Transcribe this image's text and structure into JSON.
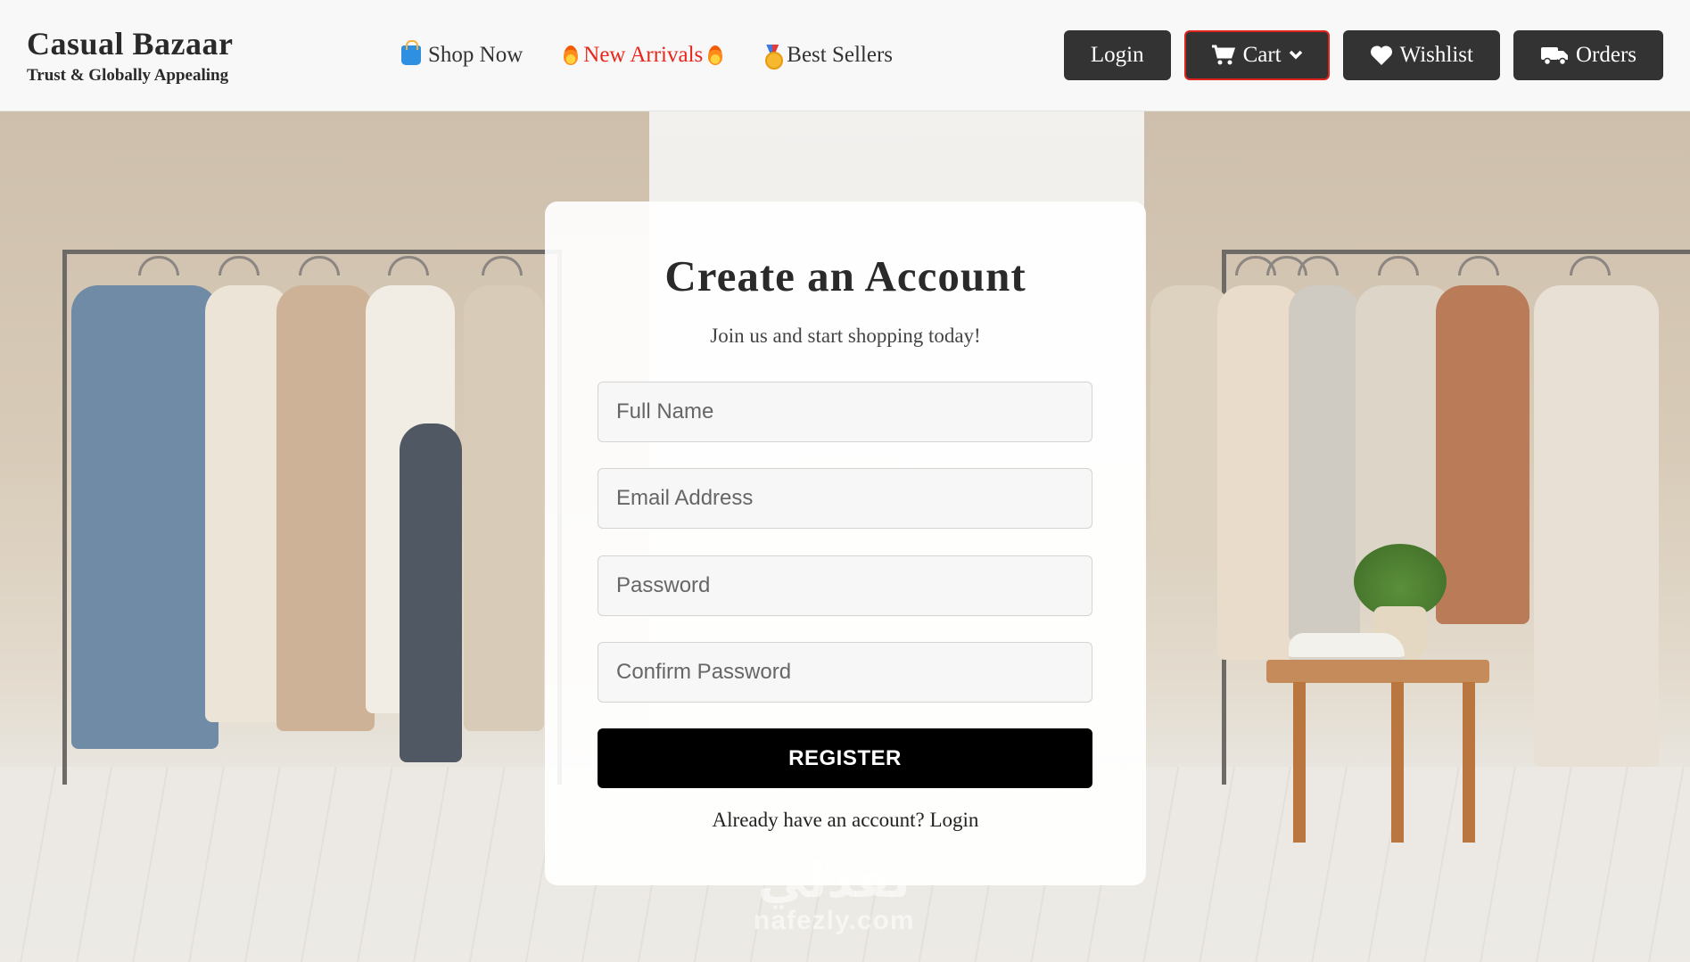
{
  "header": {
    "brand_name": "Casual Bazaar",
    "brand_tagline": "Trust & Globally Appealing",
    "nav": [
      {
        "label": "Shop Now",
        "icon": "shopping-bag-icon"
      },
      {
        "label": "New Arrivals",
        "icon": "fire-icon"
      },
      {
        "label": "Best Sellers",
        "icon": "medal-icon"
      }
    ],
    "actions": {
      "login": "Login",
      "cart": "Cart",
      "wishlist": "Wishlist",
      "orders": "Orders"
    }
  },
  "form": {
    "title": "Create an Account",
    "subtitle": "Join us and start shopping today!",
    "fields": {
      "full_name": {
        "placeholder": "Full Name",
        "value": ""
      },
      "email": {
        "placeholder": "Email Address",
        "value": ""
      },
      "password": {
        "placeholder": "Password",
        "value": ""
      },
      "confirm_password": {
        "placeholder": "Confirm Password",
        "value": ""
      }
    },
    "register_label": "REGISTER",
    "footer_prefix": "Already have an account?",
    "footer_link": "Login"
  },
  "watermark": {
    "arabic": "نفذلي",
    "latin": "nafezly.com"
  },
  "colors": {
    "accent_red": "#e8261c",
    "button_dark": "#333333",
    "register_bg": "#000000"
  }
}
